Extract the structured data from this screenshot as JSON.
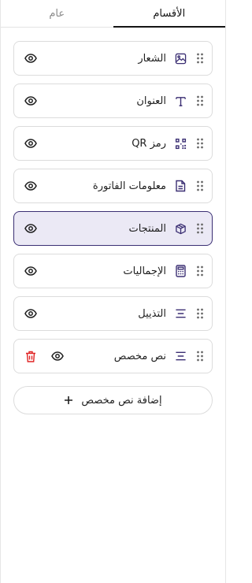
{
  "tabs": {
    "general": "عام",
    "sections": "الأقسام"
  },
  "sections": [
    {
      "label": "الشعار",
      "icon": "image-icon"
    },
    {
      "label": "العنوان",
      "icon": "text-icon"
    },
    {
      "label": "رمز QR",
      "icon": "qr-code-icon"
    },
    {
      "label": "معلومات الفاتورة",
      "icon": "document-icon"
    },
    {
      "label": "المنتجات",
      "icon": "box-icon",
      "selected": true
    },
    {
      "label": "الإجماليات",
      "icon": "calculator-icon"
    },
    {
      "label": "التذييل",
      "icon": "align-center-icon"
    },
    {
      "label": "نص مخصص",
      "icon": "align-center-icon",
      "deletable": true
    }
  ],
  "add_button_label": "إضافة نص مخصص",
  "colors": {
    "accent": "#3b2f73",
    "selected_bg": "#ebe9f5",
    "delete": "#e02424"
  }
}
